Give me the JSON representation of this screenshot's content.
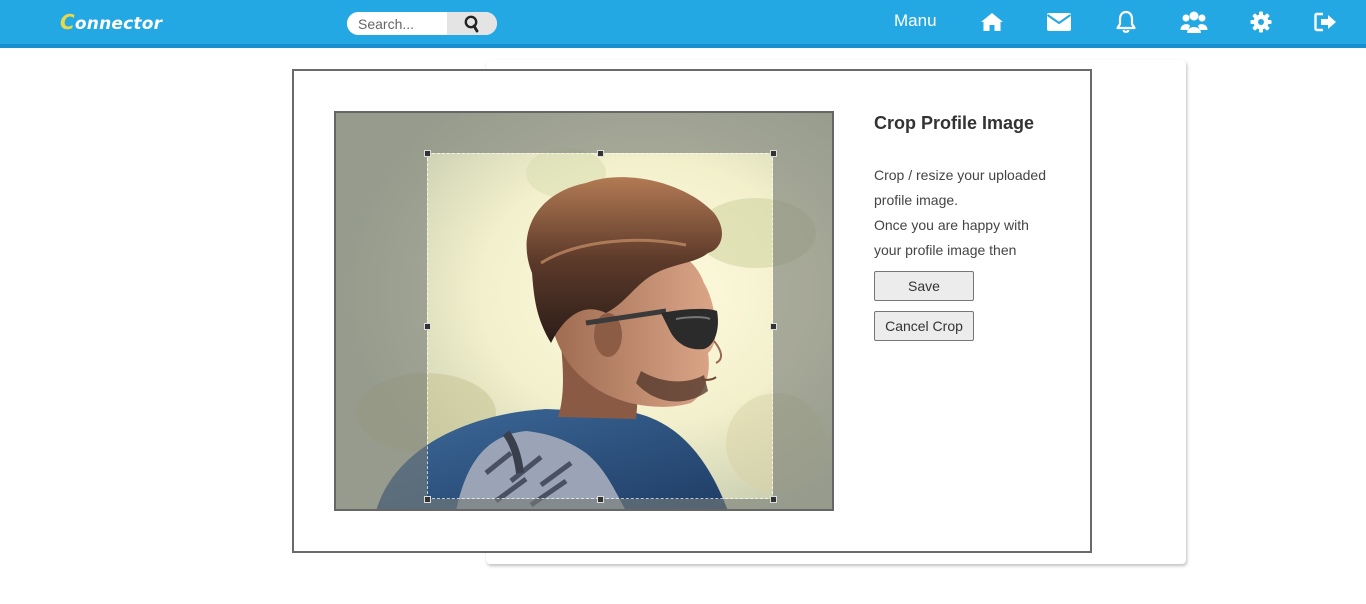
{
  "header": {
    "logo_first": "C",
    "logo_rest": "onnector",
    "search_placeholder": "Search...",
    "menu_label": "Manu",
    "nav_icons": [
      "home-icon",
      "envelope-icon",
      "bell-icon",
      "users-icon",
      "gear-icon",
      "sign-out-icon"
    ]
  },
  "crop": {
    "title": "Crop Profile Image",
    "description_line1": "Crop / resize your uploaded",
    "description_line2": "profile image.",
    "description_line3": "Once you are happy with",
    "description_line4": "your profile image then",
    "save_label": "Save",
    "cancel_label": "Cancel Crop"
  },
  "colors": {
    "topbar": "#24a8e4",
    "topbar_border": "#178ed0",
    "logo_accent": "#e9d84a"
  }
}
